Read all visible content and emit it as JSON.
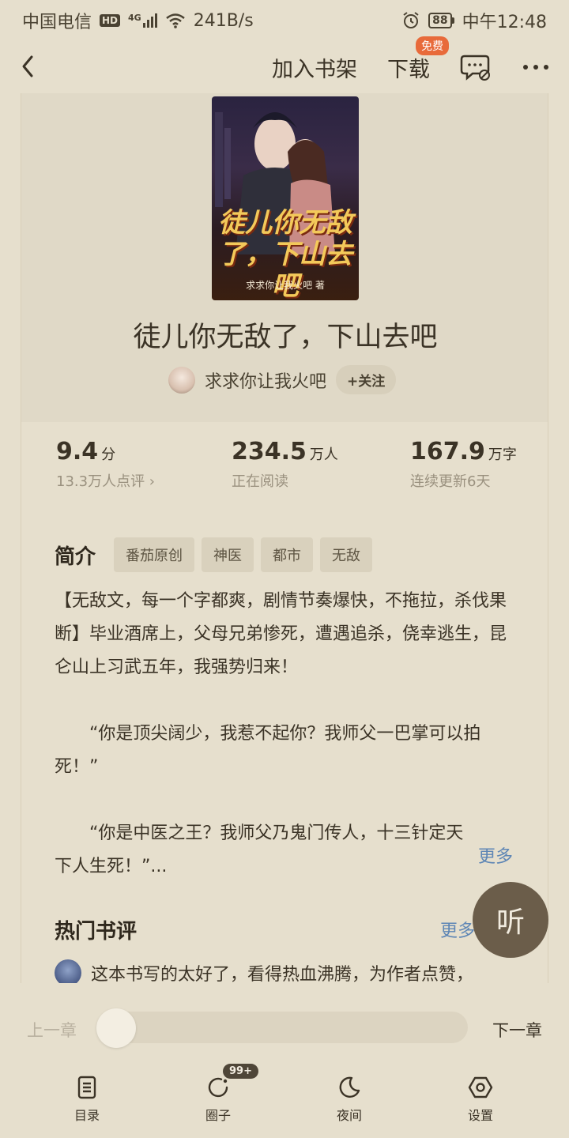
{
  "status_bar": {
    "carrier": "中国电信",
    "hd": "HD",
    "network": "4G",
    "speed": "241B/s",
    "battery": "88",
    "time": "中午12:48"
  },
  "top_bar": {
    "add_to_shelf": "加入书架",
    "download": "下载",
    "free_badge": "免费"
  },
  "book": {
    "cover_title": "徒儿你无敌了，下山去吧",
    "cover_author": "求求你让我火吧 著",
    "title": "徒儿你无敌了，下山去吧",
    "author": "求求你让我火吧",
    "follow": "+关注"
  },
  "stats": [
    {
      "value": "9.4",
      "unit": "分",
      "sub": "13.3万人点评 ›"
    },
    {
      "value": "234.5",
      "unit": "万人",
      "sub": "正在阅读"
    },
    {
      "value": "167.9",
      "unit": "万字",
      "sub": "连续更新6天"
    }
  ],
  "intro": {
    "title": "简介",
    "tags": [
      "番茄原创",
      "神医",
      "都市",
      "无敌"
    ],
    "paragraphs": [
      "【无敌文，每一个字都爽，剧情节奏爆快，不拖拉，杀伐果断】毕业酒席上，父母兄弟惨死，遭遇追杀，侥幸逃生，昆仑山上习武五年，我强势归来！",
      "“你是顶尖阔少，我惹不起你？我师父一巴掌可以拍死！”",
      "“你是中医之王？我师父乃鬼门传人，十三针定天下人生死！”..."
    ],
    "more": "更多"
  },
  "reviews": {
    "title": "热门书评",
    "more": "更多",
    "first_review": "这本书写的太好了，看得热血沸腾，为作者点赞，"
  },
  "listen_button": "听",
  "chapter_nav": {
    "prev": "上一章",
    "next": "下一章",
    "progress": 0
  },
  "bottom_nav": [
    {
      "label": "目录",
      "icon": "catalog-icon"
    },
    {
      "label": "圈子",
      "icon": "circle-icon",
      "badge": "99+"
    },
    {
      "label": "夜间",
      "icon": "moon-icon"
    },
    {
      "label": "设置",
      "icon": "settings-icon"
    }
  ]
}
